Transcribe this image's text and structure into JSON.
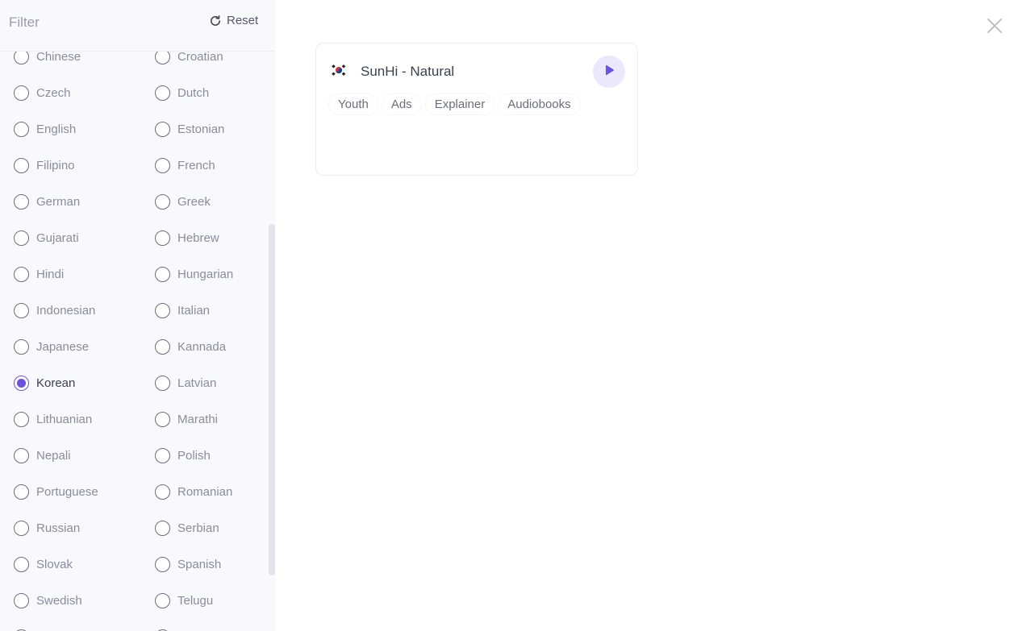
{
  "sidebar": {
    "title": "Filter",
    "reset_label": "Reset",
    "languages": [
      [
        "Chinese",
        "Croatian"
      ],
      [
        "Czech",
        "Dutch"
      ],
      [
        "English",
        "Estonian"
      ],
      [
        "Filipino",
        "French"
      ],
      [
        "German",
        "Greek"
      ],
      [
        "Gujarati",
        "Hebrew"
      ],
      [
        "Hindi",
        "Hungarian"
      ],
      [
        "Indonesian",
        "Italian"
      ],
      [
        "Japanese",
        "Kannada"
      ],
      [
        "Korean",
        "Latvian"
      ],
      [
        "Lithuanian",
        "Marathi"
      ],
      [
        "Nepali",
        "Polish"
      ],
      [
        "Portuguese",
        "Romanian"
      ],
      [
        "Russian",
        "Serbian"
      ],
      [
        "Slovak",
        "Spanish"
      ],
      [
        "Swedish",
        "Telugu"
      ],
      [
        "",
        ""
      ]
    ],
    "selected_language": "Korean"
  },
  "voice_card": {
    "flag_icon": "south-korea-flag-icon",
    "name": "SunHi - Natural",
    "tags": [
      "Youth",
      "Ads",
      "Explainer",
      "Audiobooks"
    ]
  },
  "colors": {
    "accent": "#6c52e0",
    "play_bg": "#ebe8fd",
    "sidebar_bg": "#f8f8fd"
  },
  "icons": {
    "reset": "refresh-icon",
    "close": "close-icon",
    "play": "play-icon"
  }
}
